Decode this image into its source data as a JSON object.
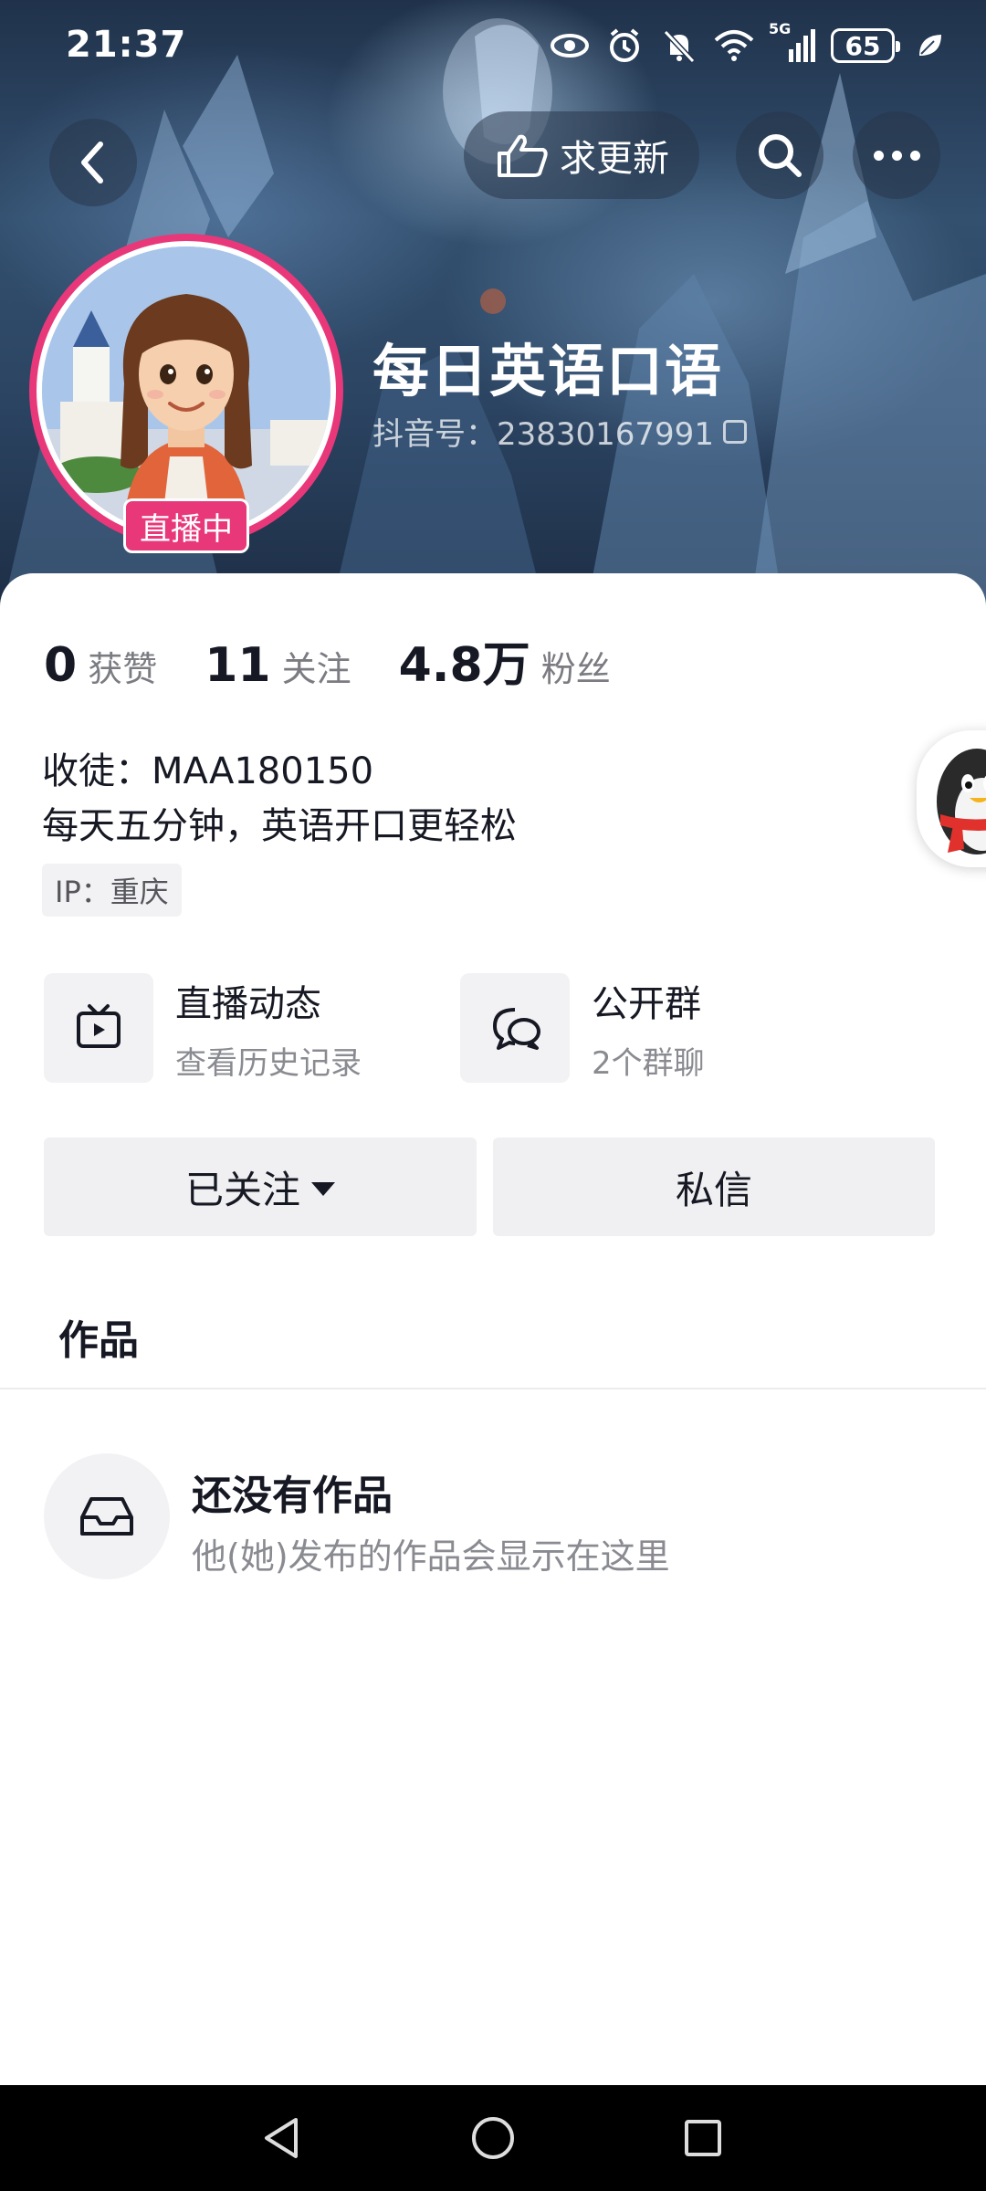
{
  "status_bar": {
    "time": "21:37",
    "network": "5G",
    "battery": "65"
  },
  "nav": {
    "update_label": "求更新"
  },
  "profile": {
    "name": "每日英语口语",
    "douyin_id": "抖音号：23830167991",
    "live_badge": "直播中"
  },
  "stats": [
    {
      "value": "0",
      "label": "获赞"
    },
    {
      "value": "11",
      "label": "关注"
    },
    {
      "value": "4.8万",
      "label": "粉丝"
    }
  ],
  "bio": {
    "line1": "收徒：MAA180150",
    "line2": "每天五分钟，英语开口更轻松",
    "ip": "IP：重庆"
  },
  "features": {
    "live": {
      "title": "直播动态",
      "subtitle": "查看历史记录"
    },
    "group": {
      "title": "公开群",
      "subtitle": "2个群聊"
    }
  },
  "actions": {
    "follow_label": "已关注",
    "message_label": "私信"
  },
  "tabs": {
    "works": "作品"
  },
  "empty_state": {
    "title": "还没有作品",
    "subtitle": "他(她)发布的作品会显示在这里"
  },
  "colors": {
    "accent": "#e8387a",
    "card_bg": "#ffffff",
    "button_bg": "#f0f0f2"
  },
  "icons": [
    "back-icon",
    "hand-point-icon",
    "search-icon",
    "more-icon",
    "eye-icon",
    "alarm-icon",
    "bell-off-icon",
    "wifi-icon",
    "signal-icon",
    "leaf-icon",
    "tv-play-icon",
    "chat-bubbles-icon",
    "inbox-icon",
    "qq-penguin-icon",
    "nav-back-icon",
    "nav-home-icon",
    "nav-recents-icon"
  ]
}
